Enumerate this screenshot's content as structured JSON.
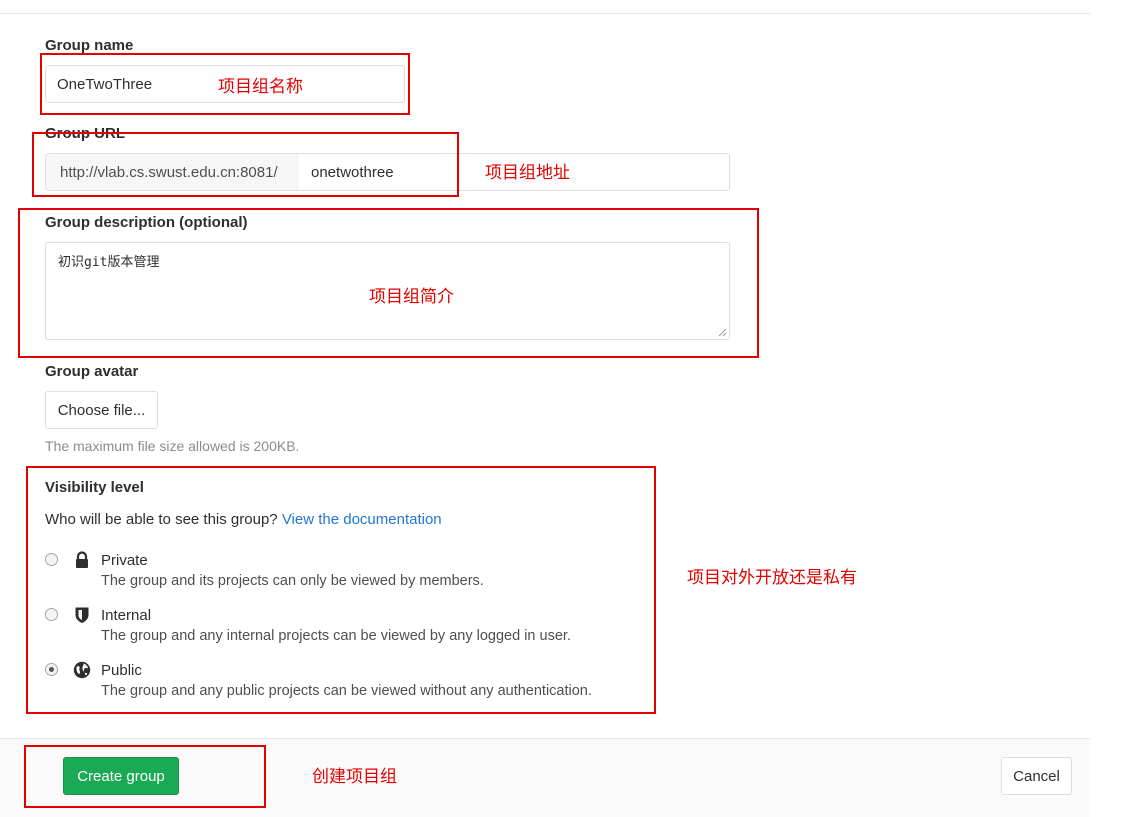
{
  "form": {
    "group_name_label": "Group name",
    "group_name_value": "OneTwoThree",
    "group_url_label": "Group URL",
    "group_url_prefix": "http://vlab.cs.swust.edu.cn:8081/",
    "group_url_value": "onetwothree",
    "description_label": "Group description (optional)",
    "description_value": "初识git版本管理",
    "avatar_label": "Group avatar",
    "choose_file_label": "Choose file...",
    "avatar_help": "The maximum file size allowed is 200KB."
  },
  "visibility": {
    "title": "Visibility level",
    "question": "Who will be able to see this group?",
    "doc_link": "View the documentation",
    "selected": "Public",
    "options": [
      {
        "title": "Private",
        "description": "The group and its projects can only be viewed by members.",
        "icon": "lock-icon"
      },
      {
        "title": "Internal",
        "description": "The group and any internal projects can be viewed by any logged in user.",
        "icon": "shield-icon"
      },
      {
        "title": "Public",
        "description": "The group and any public projects can be viewed without any authentication.",
        "icon": "globe-icon"
      }
    ]
  },
  "footer": {
    "create_label": "Create group",
    "cancel_label": "Cancel"
  },
  "annotations": {
    "group_name": "项目组名称",
    "group_url": "项目组地址",
    "description": "项目组简介",
    "visibility": "项目对外开放还是私有",
    "create": "创建项目组"
  },
  "colors": {
    "annotation": "#e30000",
    "primary_button": "#1aaa55",
    "link": "#1f78d1"
  }
}
